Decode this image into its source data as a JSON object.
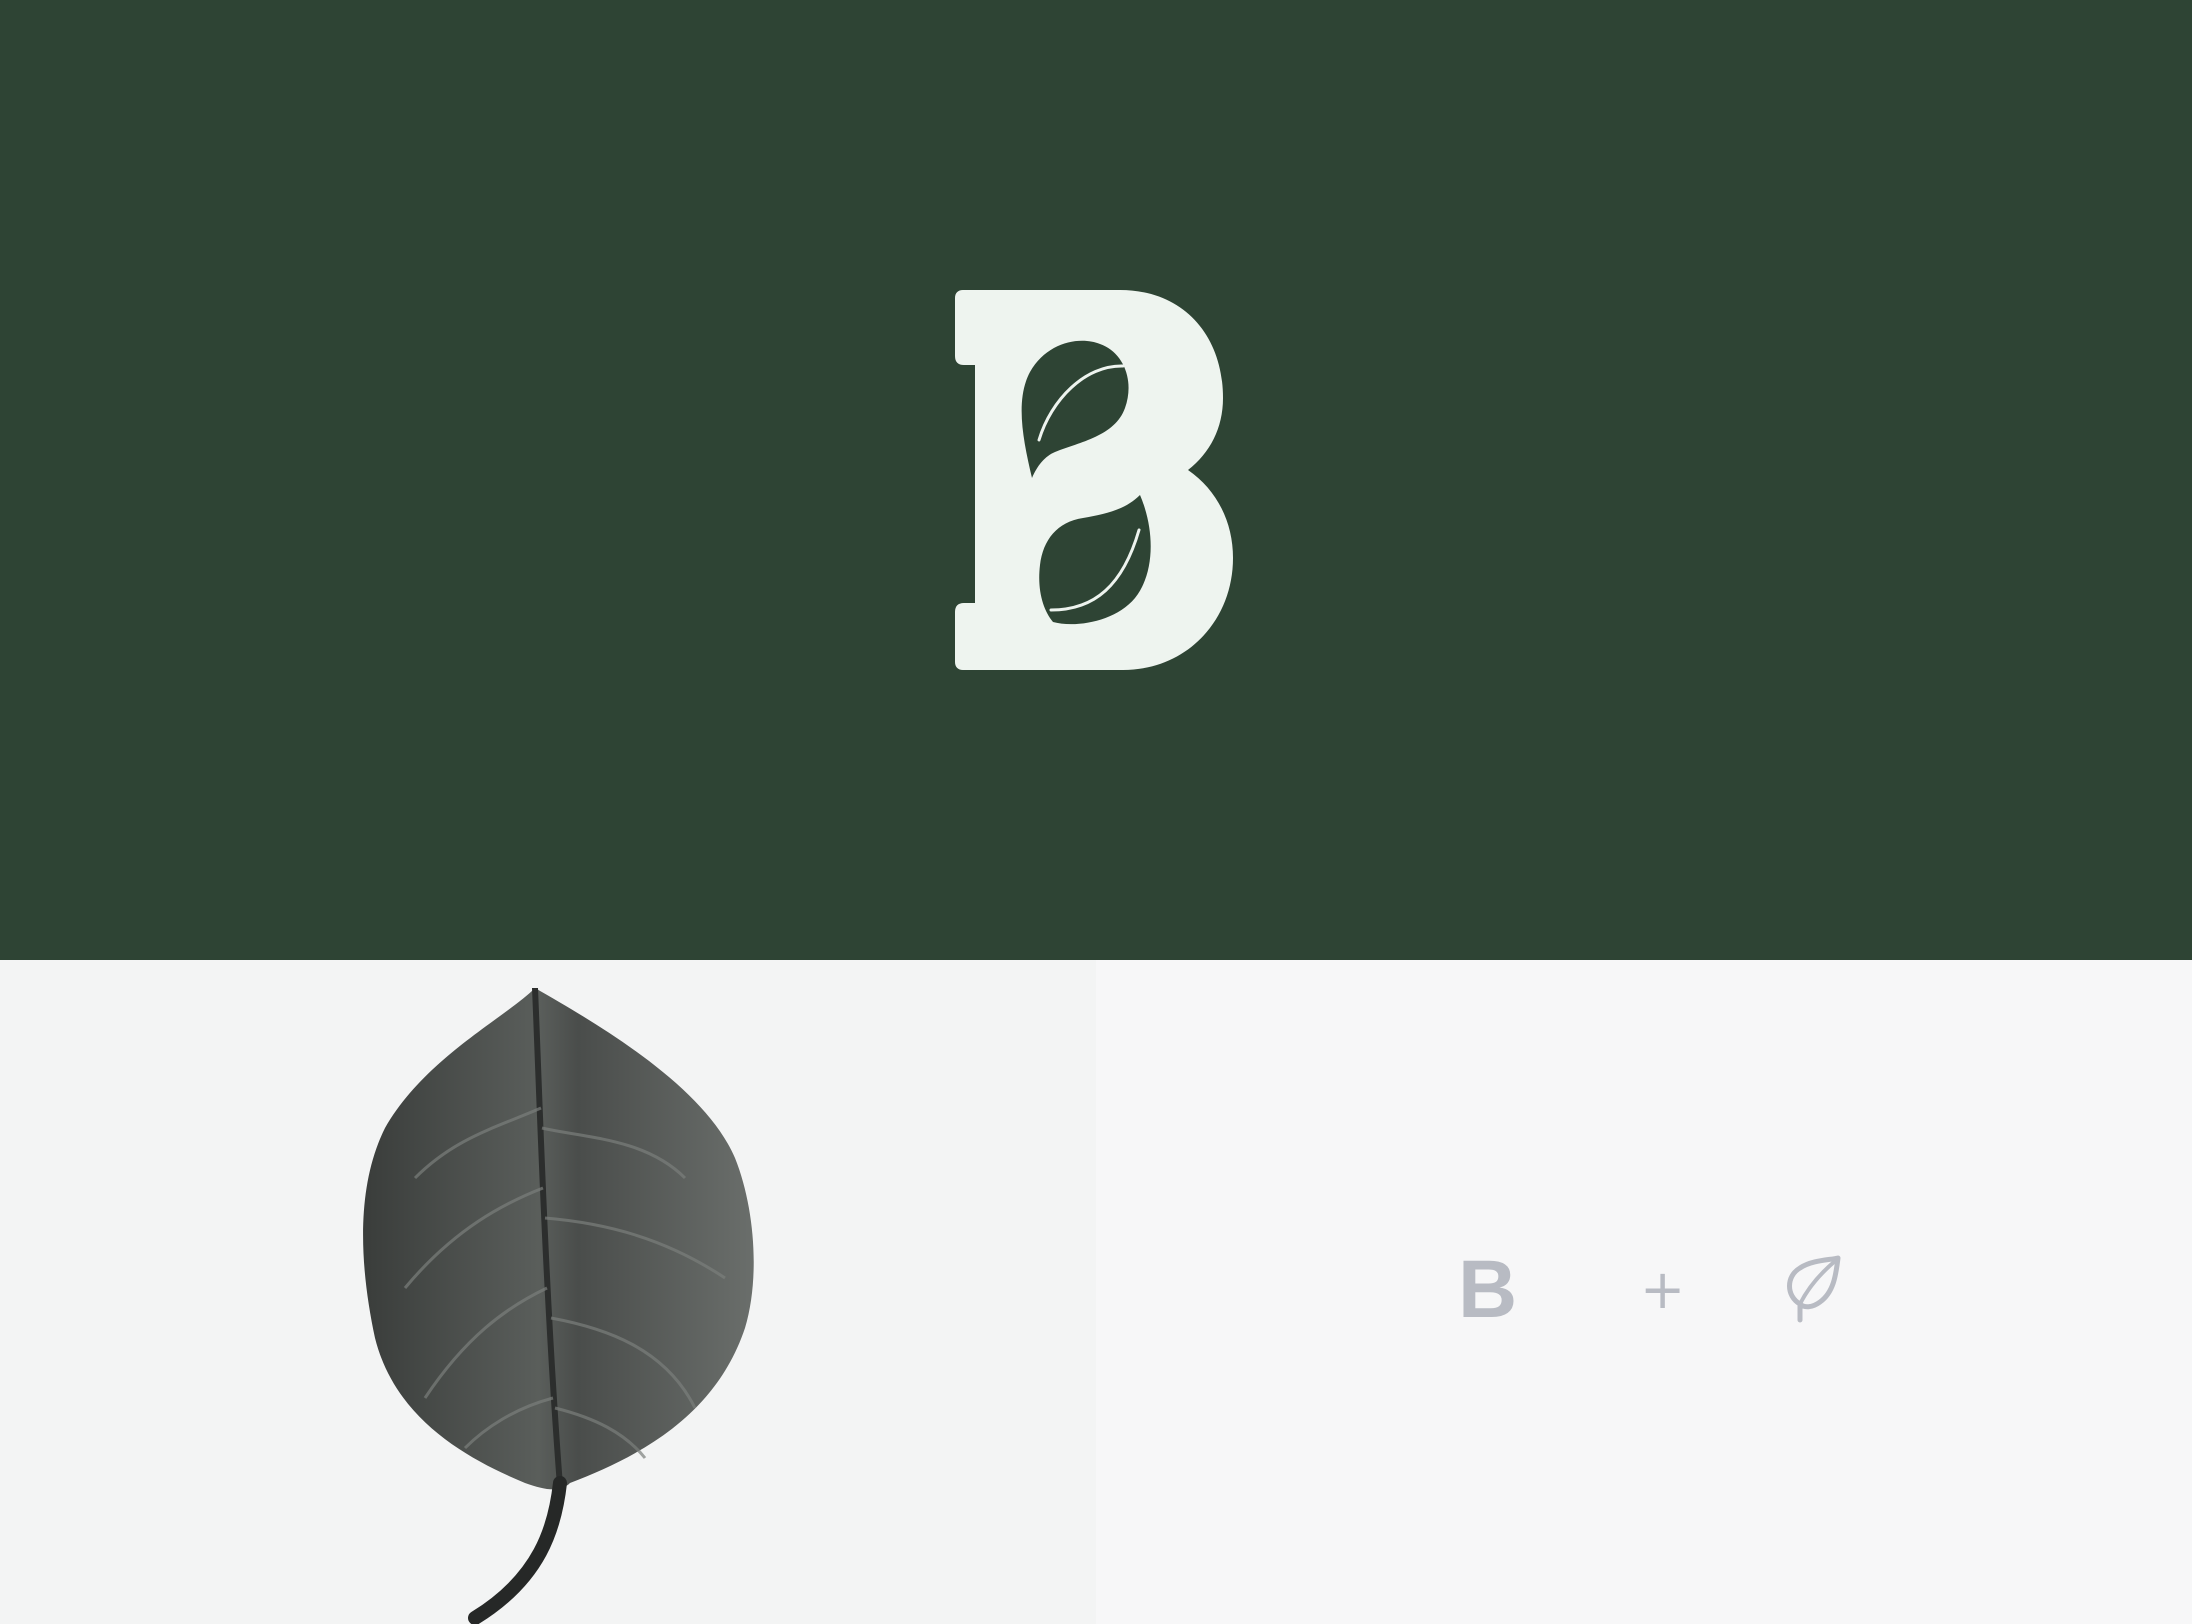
{
  "brand": {
    "monogram_letter": "B",
    "background_color": "#2e4434",
    "logo_color": "#eef4ef"
  },
  "concept": {
    "letter": "B",
    "operator": "+",
    "icon": "leaf-icon",
    "text_color": "#b8bbc3"
  },
  "photo": {
    "subject": "leaf-photo"
  }
}
